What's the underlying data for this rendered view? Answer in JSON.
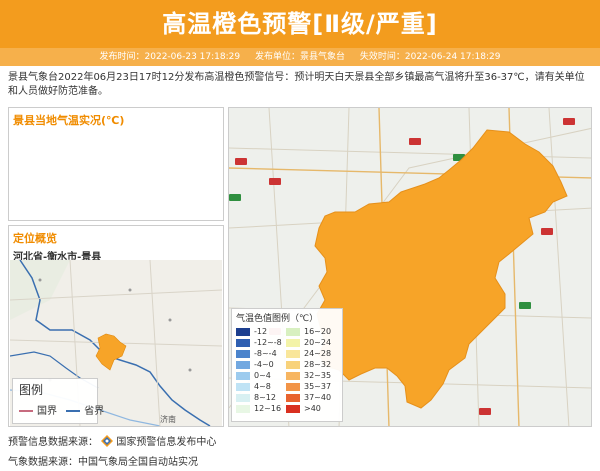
{
  "banner": {
    "title": "高温橙色预警[Ⅱ级/严重]"
  },
  "info": {
    "publish_time": "发布时间：2022-06-23 17:18:29",
    "publisher": "发布单位：景县气象台",
    "expire_time": "失效时间：2022-06-24 17:18:29"
  },
  "description": "景县气象台2022年06月23日17时12分发布高温橙色预警信号：预计明天白天景县全部乡镇最高气温将升至36-37℃，请有关单位和人员做好防范准备。",
  "temp_panel": {
    "title": "景县当地气温实况(℃)"
  },
  "location_panel": {
    "title": "定位概览",
    "place": "河北省-衡水市-景县"
  },
  "small_map": {
    "legend_title": "图例",
    "legend_items": [
      {
        "label": "国界",
        "color": "#c76b7e"
      },
      {
        "label": "省界",
        "color": "#3a6fb0"
      }
    ],
    "city_label": "济南"
  },
  "temp_legend": {
    "title": "气温色值图例（℃）",
    "left": [
      {
        "label": "-12",
        "color": "#1d3f8f"
      },
      {
        "label": "-12~-8",
        "color": "#2f5fb1"
      },
      {
        "label": "-8~-4",
        "color": "#4b84cc"
      },
      {
        "label": "-4~0",
        "color": "#72a8e0"
      },
      {
        "label": "0~4",
        "color": "#9ccbee"
      },
      {
        "label": "4~8",
        "color": "#bfe3f5"
      },
      {
        "label": "8~12",
        "color": "#d8f0f2"
      },
      {
        "label": "12~16",
        "color": "#e8f7e4"
      }
    ],
    "right": [
      {
        "label": "16~20",
        "color": "#d8f0c0"
      },
      {
        "label": "20~24",
        "color": "#f3f3a8"
      },
      {
        "label": "24~28",
        "color": "#f9e69a"
      },
      {
        "label": "28~32",
        "color": "#f8d27a"
      },
      {
        "label": "32~35",
        "color": "#f7b560"
      },
      {
        "label": "35~37",
        "color": "#f29447"
      },
      {
        "label": "37~40",
        "color": "#e8632e"
      },
      {
        "label": ">40",
        "color": "#d9301f"
      }
    ]
  },
  "sources": {
    "warning": "预警信息数据来源：",
    "warning_org": "国家预警信息发布中心",
    "weather": "气象数据来源：中国气象局全国自动站实况"
  },
  "colors": {
    "accent": "#f39c1e",
    "region_fill": "#f7a428"
  }
}
